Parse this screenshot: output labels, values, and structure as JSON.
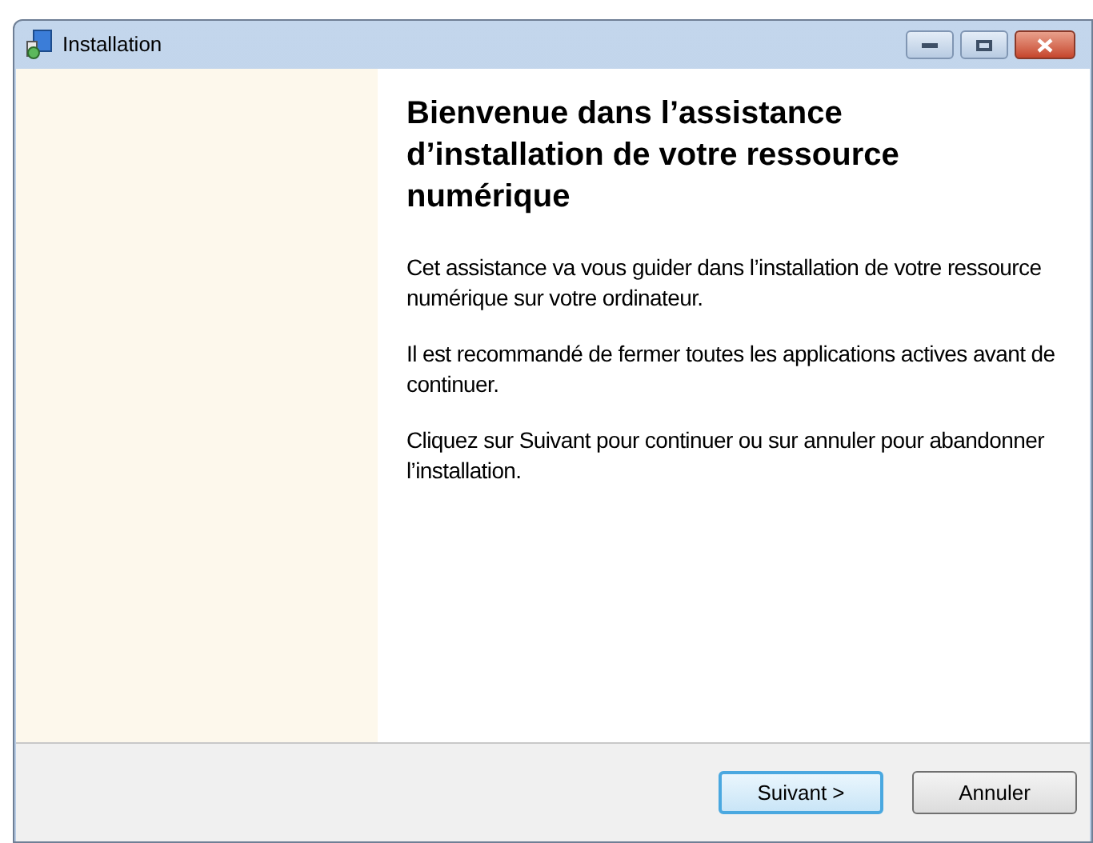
{
  "window": {
    "title": "Installation"
  },
  "heading": "Bienvenue dans l’assistance d’installation de votre ressource numérique",
  "paragraphs": [
    "Cet assistance va vous guider dans l’installation de votre ressource numérique sur votre ordinateur.",
    "Il est recommandé de fermer toutes les applications actives avant de continuer.",
    "Cliquez sur Suivant pour continuer ou sur annuler pour abandonner l’installation."
  ],
  "buttons": [
    {
      "label": "Suivant >",
      "focused": true
    },
    {
      "label": "Annuler",
      "focused": false
    }
  ]
}
